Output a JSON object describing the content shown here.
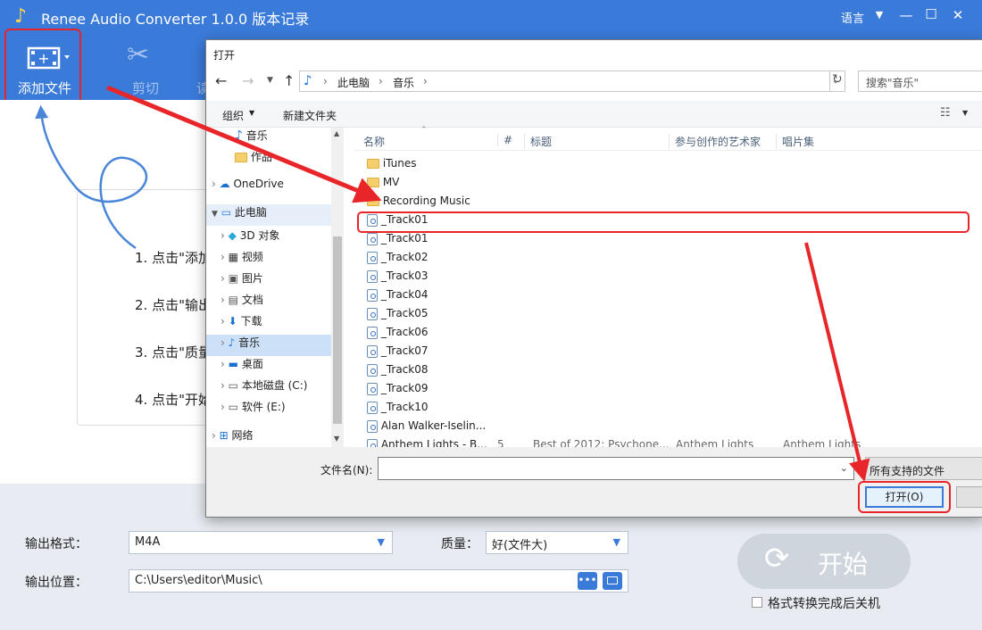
{
  "app": {
    "title": "Renee Audio Converter 1.0.0 版本记录",
    "language": "语言",
    "window_controls": {
      "dropdown": "▼",
      "minimize": "—",
      "maximize": "☐",
      "close": "✕"
    }
  },
  "toolbar": {
    "add_file": "添加文件",
    "cut": "剪切",
    "third_partial": "读"
  },
  "steps": [
    "1. 点击\"添加",
    "2. 点击\"输出",
    "3. 点击\"质量",
    "4. 点击\"开始"
  ],
  "bottom": {
    "format_label": "输出格式：",
    "format_value": "M4A",
    "quality_label": "质量：",
    "quality_value": "好(文件大)",
    "location_label": "输出位置：",
    "location_value": "C:\\Users\\editor\\Music\\",
    "start_button": "开始",
    "shutdown_label": "格式转换完成后关机"
  },
  "dialog": {
    "title": "打开",
    "breadcrumb": [
      "此电脑",
      "音乐"
    ],
    "search_placeholder": "搜索\"音乐\"",
    "organize": "组织",
    "new_folder": "新建文件夹",
    "nav_items": [
      {
        "label": "音乐",
        "icon": "music-icon"
      },
      {
        "label": "作品",
        "icon": "folder-icon"
      },
      {
        "label": "OneDrive",
        "icon": "cloud-icon"
      },
      {
        "label": "此电脑",
        "icon": "computer-icon"
      },
      {
        "label": "3D 对象",
        "icon": "cube-icon"
      },
      {
        "label": "视频",
        "icon": "video-icon"
      },
      {
        "label": "图片",
        "icon": "picture-icon"
      },
      {
        "label": "文档",
        "icon": "document-icon"
      },
      {
        "label": "下载",
        "icon": "download-icon"
      },
      {
        "label": "音乐",
        "icon": "music-icon"
      },
      {
        "label": "桌面",
        "icon": "desktop-icon"
      },
      {
        "label": "本地磁盘 (C:)",
        "icon": "drive-icon"
      },
      {
        "label": "软件 (E:)",
        "icon": "drive-icon"
      },
      {
        "label": "网络",
        "icon": "network-icon"
      }
    ],
    "columns": [
      "名称",
      "#",
      "标题",
      "参与创作的艺术家",
      "唱片集"
    ],
    "files": [
      {
        "name": "iTunes",
        "type": "folder"
      },
      {
        "name": "MV",
        "type": "folder"
      },
      {
        "name": "Recording Music",
        "type": "folder"
      },
      {
        "name": "_Track01",
        "type": "audio"
      },
      {
        "name": "_Track01",
        "type": "audio"
      },
      {
        "name": "_Track02",
        "type": "audio"
      },
      {
        "name": "_Track03",
        "type": "audio"
      },
      {
        "name": "_Track04",
        "type": "audio"
      },
      {
        "name": "_Track05",
        "type": "audio"
      },
      {
        "name": "_Track06",
        "type": "audio"
      },
      {
        "name": "_Track07",
        "type": "audio"
      },
      {
        "name": "_Track08",
        "type": "audio"
      },
      {
        "name": "_Track09",
        "type": "audio"
      },
      {
        "name": "_Track10",
        "type": "audio"
      },
      {
        "name": "Alan Walker-Iselin...",
        "type": "audio"
      }
    ],
    "last_row": {
      "name": "Anthem Lights - B...",
      "num": "5",
      "title": "Best of 2012: Psychone...",
      "artist": "Anthem Lights",
      "album": "Anthem Lights -..."
    },
    "filename_label": "文件名(N):",
    "filename_value": "",
    "filetype_value": "所有支持的文件",
    "open_button": "打开(O)"
  },
  "colors": {
    "accent": "#3a7ad9",
    "annotation": "#e8262a",
    "start_button": "#cfd5dd"
  }
}
